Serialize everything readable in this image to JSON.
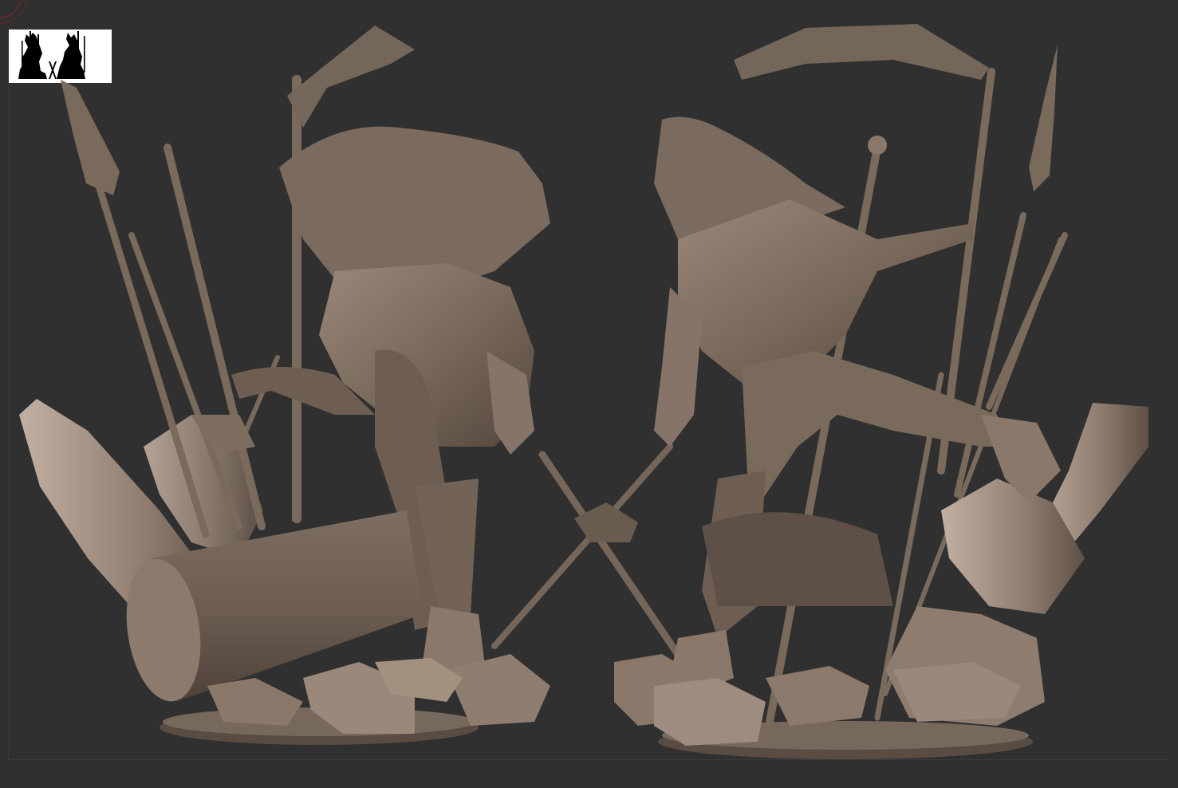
{
  "viewport": {
    "background": "#303030",
    "clay_color": "#7a6a5c",
    "clay_highlight": "#a8968a",
    "clay_shadow": "#4a3e36"
  },
  "thumbnail": {
    "icon": "twin-figure-silhouette-icon",
    "background": "#ffffff"
  },
  "models": [
    {
      "view": "back",
      "icon": "sculpt-figure-back-icon"
    },
    {
      "view": "front",
      "icon": "sculpt-figure-front-icon"
    }
  ]
}
